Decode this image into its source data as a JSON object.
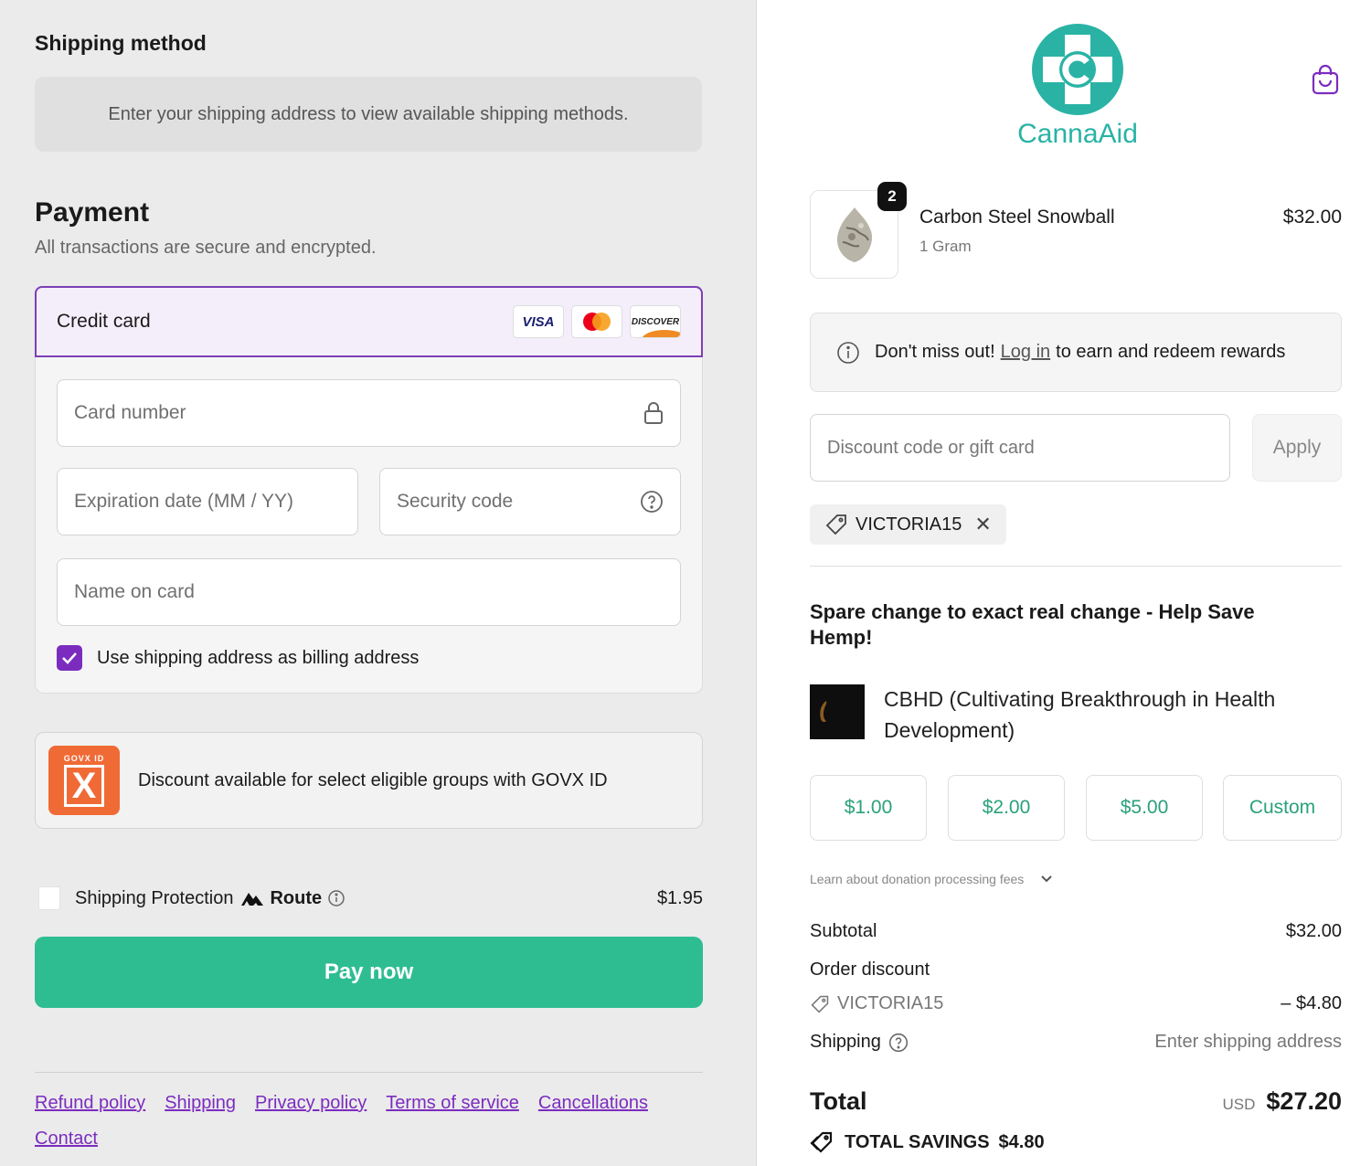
{
  "shipping": {
    "heading": "Shipping method",
    "notice": "Enter your shipping address to view available shipping methods."
  },
  "payment": {
    "heading": "Payment",
    "subtitle": "All transactions are secure and encrypted.",
    "method_label": "Credit card",
    "card_logos": [
      "VISA",
      "Mastercard",
      "DISCOVER"
    ],
    "card_number_placeholder": "Card number",
    "expiry_placeholder": "Expiration date (MM / YY)",
    "security_placeholder": "Security code",
    "name_placeholder": "Name on card",
    "billing_checkbox_label": "Use shipping address as billing address",
    "billing_checked": true
  },
  "govx": {
    "logo_text": "GOVX ID",
    "text": "Discount available for select eligible groups with GOVX ID"
  },
  "protection": {
    "label": "Shipping Protection",
    "brand": "Route",
    "price": "$1.95",
    "checked": false
  },
  "pay_button": "Pay now",
  "footer_links": [
    "Refund policy",
    "Shipping",
    "Privacy policy",
    "Terms of service",
    "Cancellations",
    "Contact"
  ],
  "brand": {
    "name": "CannaAid",
    "color": "#2ab3a5"
  },
  "cart": {
    "item": {
      "name": "Carbon Steel Snowball",
      "variant": "1 Gram",
      "price": "$32.00",
      "quantity": "2"
    }
  },
  "rewards": {
    "prefix": "Don't miss out!",
    "link": "Log in",
    "suffix": "to earn and redeem rewards"
  },
  "discount": {
    "placeholder": "Discount code or gift card",
    "apply_label": "Apply",
    "applied_code": "VICTORIA15"
  },
  "donation": {
    "title": "Spare change to exact real change - Help Save Hemp!",
    "cause": "CBHD (Cultivating Breakthrough in Health Development)",
    "amounts": [
      "$1.00",
      "$2.00",
      "$5.00",
      "Custom"
    ],
    "learn_more": "Learn about donation processing fees"
  },
  "summary": {
    "subtotal_label": "Subtotal",
    "subtotal": "$32.00",
    "order_discount_label": "Order discount",
    "discount_code": "VICTORIA15",
    "discount_amount": "– $4.80",
    "shipping_label": "Shipping",
    "shipping_value": "Enter shipping address",
    "total_label": "Total",
    "currency": "USD",
    "total": "$27.20",
    "savings_label": "TOTAL SAVINGS",
    "savings": "$4.80"
  },
  "colors": {
    "accent_purple": "#7b2cbf",
    "pay_green": "#2ebd91",
    "donation_green": "#2aa17c"
  }
}
